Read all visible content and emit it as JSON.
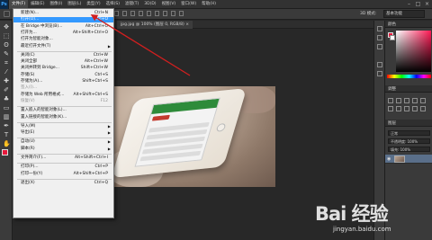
{
  "app": {
    "logo": "Ps"
  },
  "menubar": {
    "items": [
      "文件(F)",
      "编辑(E)",
      "图像(I)",
      "图层(L)",
      "类型(Y)",
      "选择(S)",
      "滤镜(T)",
      "3D(D)",
      "视图(V)",
      "窗口(W)",
      "帮助(H)"
    ],
    "active_index": 0
  },
  "optionsbar": {
    "label": "3D 模式:",
    "select": "基本功能"
  },
  "document_tab": {
    "title": "jpg.jpg @ 100% (图层 0, RGB/8) × "
  },
  "file_menu": {
    "items": [
      {
        "label": "新建(N)...",
        "shortcut": "Ctrl+N"
      },
      {
        "label": "打开(O)...",
        "shortcut": "Ctrl+O",
        "highlight": true
      },
      {
        "label": "在 Bridge 中浏览(B)...",
        "shortcut": "Alt+Ctrl+O"
      },
      {
        "label": "打开为...",
        "shortcut": "Alt+Shift+Ctrl+O"
      },
      {
        "label": "打开为智能对象..."
      },
      {
        "label": "最近打开文件(T)",
        "submenu": true
      },
      {
        "sep": true
      },
      {
        "label": "关闭(C)",
        "shortcut": "Ctrl+W"
      },
      {
        "label": "关闭全部",
        "shortcut": "Alt+Ctrl+W"
      },
      {
        "label": "关闭并转到 Bridge...",
        "shortcut": "Shift+Ctrl+W"
      },
      {
        "label": "存储(S)",
        "shortcut": "Ctrl+S"
      },
      {
        "label": "存储为(A)...",
        "shortcut": "Shift+Ctrl+S"
      },
      {
        "label": "签入(I)...",
        "disabled": true
      },
      {
        "label": "存储为 Web 所用格式...",
        "shortcut": "Alt+Shift+Ctrl+S"
      },
      {
        "label": "恢复(V)",
        "shortcut": "F12",
        "disabled": true
      },
      {
        "sep": true
      },
      {
        "label": "置入嵌入的智能对象(L)..."
      },
      {
        "label": "置入链接的智能对象(K)..."
      },
      {
        "sep": true
      },
      {
        "label": "导入(M)",
        "submenu": true
      },
      {
        "label": "导出(E)",
        "submenu": true
      },
      {
        "sep": true
      },
      {
        "label": "自动(U)",
        "submenu": true
      },
      {
        "label": "脚本(R)",
        "submenu": true
      },
      {
        "sep": true
      },
      {
        "label": "文件简介(F)...",
        "shortcut": "Alt+Shift+Ctrl+I"
      },
      {
        "sep": true
      },
      {
        "label": "打印(P)...",
        "shortcut": "Ctrl+P"
      },
      {
        "label": "打印一份(Y)",
        "shortcut": "Alt+Shift+Ctrl+P"
      },
      {
        "sep": true
      },
      {
        "label": "退出(X)",
        "shortcut": "Ctrl+Q"
      }
    ]
  },
  "panels": {
    "color_tab": "颜色",
    "adjust_tab": "调整",
    "layers_tab": "图层",
    "blend_mode": "正常",
    "opacity": "不透明度: 100%",
    "lock": "锁定:",
    "fill": "填充: 100%"
  },
  "watermark": {
    "logo": "Bai 经验",
    "url": "jingyan.baidu.com"
  },
  "colors": {
    "accent": "#e8193c",
    "highlight": "#3399ff",
    "arrow": "#d21f1f"
  }
}
